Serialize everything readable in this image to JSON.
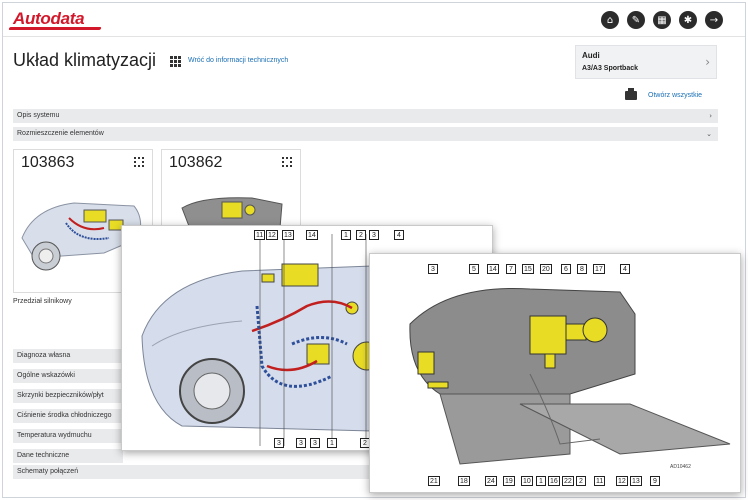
{
  "app": {
    "logo": "Autodata",
    "top_icons": [
      "home-icon",
      "wrench-icon",
      "calculator-icon",
      "gear-icon",
      "logout-icon"
    ]
  },
  "page": {
    "title": "Układ klimatyzacji",
    "back_link": "Wróć do informacji technicznych",
    "expand_all": "Otwórz wszystkie"
  },
  "vehicle": {
    "make": "Audi",
    "model": "A3/A3 Sportback"
  },
  "sections": {
    "system_description": "Opis systemu",
    "component_location": "Rozmieszczenie elementów"
  },
  "thumbnails": [
    {
      "id": "103863"
    },
    {
      "id": "103862"
    }
  ],
  "thumb_caption": "Przedział silnikowy",
  "left_list": [
    "Diagnoza własna",
    "Ogólne wskazówki",
    "Skrzynki bezpieczników/płyt",
    "Ciśnienie środka chłodniczego",
    "Temperatura wydmuchu",
    "Dane techniczne",
    "Schematy połączeń"
  ],
  "engine_callouts_top": [
    "11",
    "12",
    "13",
    "14",
    "1",
    "2",
    "3",
    "4"
  ],
  "engine_callouts_bottom": [
    "3",
    "3",
    "3",
    "1",
    "2"
  ],
  "dash_callouts_top": [
    "3",
    "5",
    "14",
    "7",
    "15",
    "20",
    "6",
    "8",
    "17",
    "4"
  ],
  "dash_callouts_bottom": [
    "21",
    "18",
    "24",
    "19",
    "10",
    "1",
    "16",
    "22",
    "2",
    "11",
    "12",
    "13",
    "9"
  ],
  "dash_code": "AD10462",
  "colors": {
    "brand": "#d2182a",
    "link": "#1a6fb5",
    "component_yellow": "#e8dc25",
    "wire_red": "#c21f1f",
    "wire_blue": "#2e4f9a"
  }
}
